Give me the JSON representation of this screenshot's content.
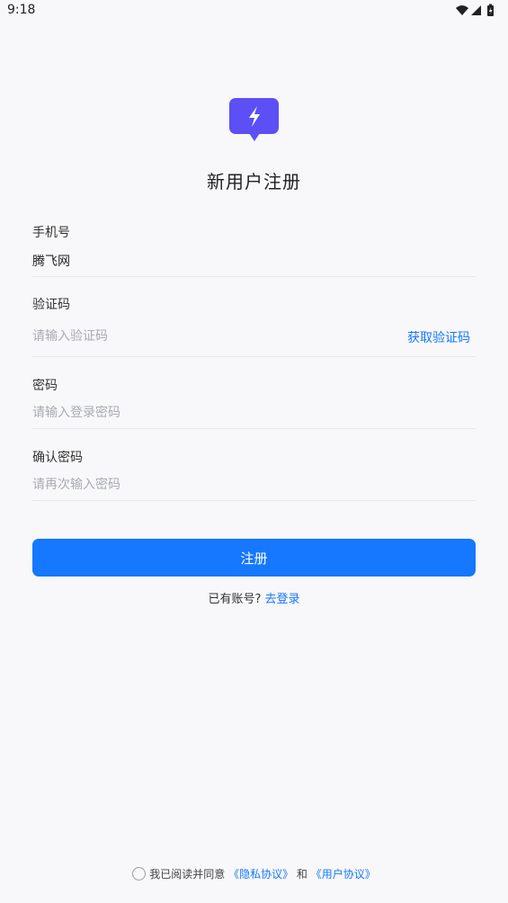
{
  "status_bar": {
    "time": "9:18",
    "icons": [
      "wifi-icon",
      "signal-icon",
      "battery-icon"
    ]
  },
  "logo": {
    "icon": "lightning-chat-bubble-icon",
    "color": "#5b4ff5"
  },
  "title": "新用户注册",
  "form": {
    "phone": {
      "label": "手机号",
      "value": "腾飞网"
    },
    "code": {
      "label": "验证码",
      "placeholder": "请输入验证码",
      "get_code_label": "获取验证码"
    },
    "password": {
      "label": "密码",
      "placeholder": "请输入登录密码"
    },
    "confirm_password": {
      "label": "确认密码",
      "placeholder": "请再次输入密码"
    }
  },
  "register_button": "注册",
  "login_prompt": {
    "text": "已有账号?",
    "link": "去登录"
  },
  "agreement": {
    "prefix": "我已阅读并同意",
    "privacy_link": "《隐私协议》",
    "and": "和",
    "user_link": "《用户协议》",
    "checked": false
  },
  "colors": {
    "accent": "#1677ff",
    "logo": "#5b4ff5",
    "background": "#f8f8fa"
  }
}
